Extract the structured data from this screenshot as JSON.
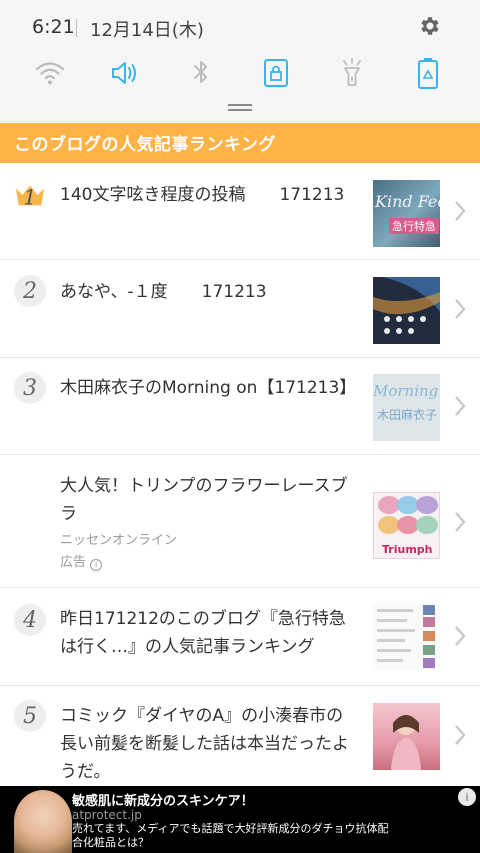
{
  "status": {
    "time": "6:21",
    "date": "12月14日(木)"
  },
  "quick_settings": {
    "icons": [
      "wifi-icon",
      "volume-icon",
      "bluetooth-icon",
      "screen-lock-icon",
      "flashlight-icon",
      "battery-saver-icon"
    ],
    "active_color": "#3bb3e6",
    "inactive_color": "#bdbdbd"
  },
  "ranking": {
    "title": "このブログの人気記事ランキング",
    "header_color": "#ffb347",
    "items": [
      {
        "rank": "1",
        "title": "140文字呟き程度の投稿　　171213"
      },
      {
        "rank": "2",
        "title": "あなや、-１度　　171213"
      },
      {
        "rank": "3",
        "title": "木田麻衣子のMorning on【171213】"
      },
      {
        "rank": "",
        "title": "大人気！トリンプのフラワーレースブラ",
        "advertiser": "ニッセンオンライン",
        "ad_label": "広告"
      },
      {
        "rank": "4",
        "title": "昨日171212のこのブログ『急行特急は行く…』の人気記事ランキング"
      },
      {
        "rank": "5",
        "title": "コミック『ダイヤのA』の小湊春市の長い前髪を断髪した話は本当だったようだ。"
      }
    ],
    "thumb_texts": {
      "t1_line1": "Kind Feeli",
      "t1_line2": "急行特急",
      "t3_line1": "Morning o",
      "t3_line2": "木田麻衣子",
      "ad_brand": "Triumph"
    }
  },
  "ad_banner": {
    "headline": "敏感肌に新成分のスキンケア！",
    "domain": "atprotect.jp",
    "body": "売れてます、メディアでも話題で大好評新成分のダチョウ抗体配合化粧品とは？"
  }
}
